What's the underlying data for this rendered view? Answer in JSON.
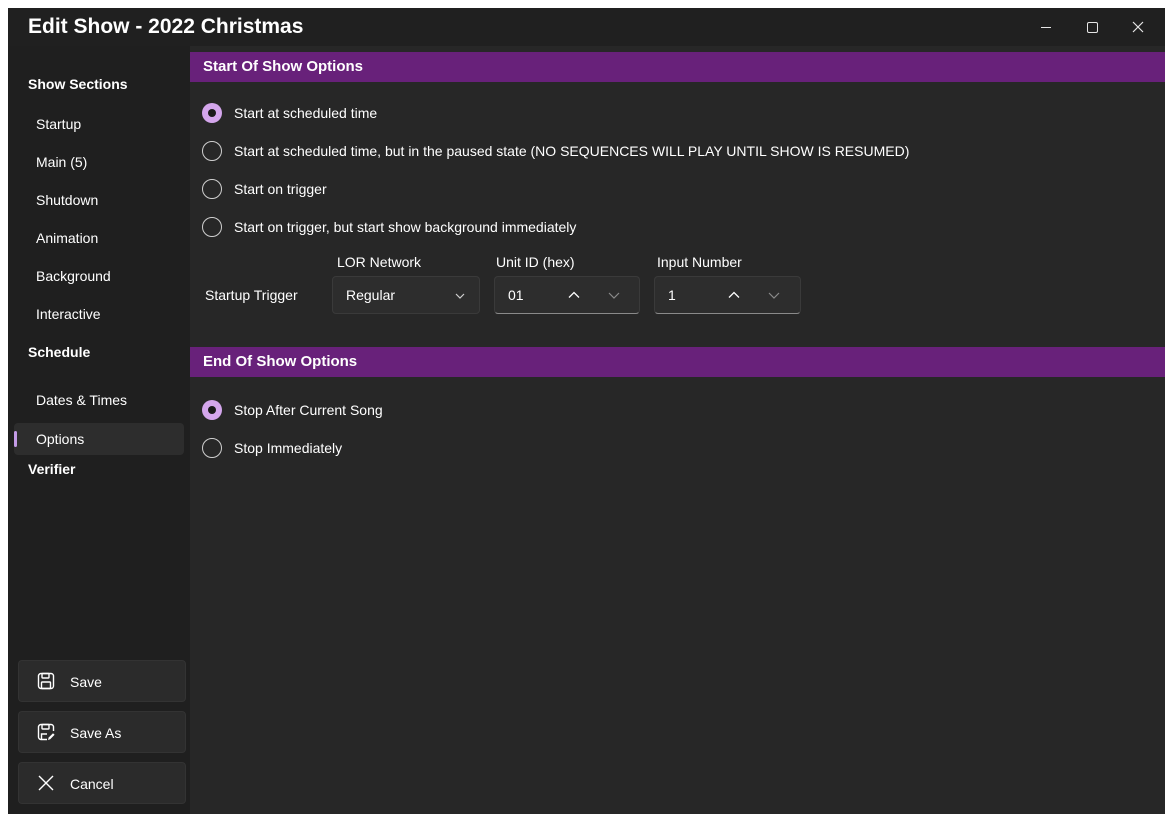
{
  "window": {
    "title": "Edit Show - 2022 Christmas",
    "controls": [
      "minimize-icon",
      "maximize-icon",
      "close-icon"
    ]
  },
  "sidebar": {
    "show_sections_header": "Show Sections",
    "show_sections": [
      {
        "label": "Startup"
      },
      {
        "label": "Main (5)"
      },
      {
        "label": "Shutdown"
      },
      {
        "label": "Animation"
      },
      {
        "label": "Background"
      },
      {
        "label": "Interactive"
      }
    ],
    "schedule_header": "Schedule",
    "schedule_items": [
      {
        "label": "Dates & Times"
      },
      {
        "label": "Options",
        "selected": true
      }
    ],
    "verifier_header": "Verifier",
    "buttons": {
      "save": "Save",
      "save_as": "Save As",
      "cancel": "Cancel"
    }
  },
  "start_options": {
    "header": "Start Of Show Options",
    "radios": [
      {
        "label": "Start at scheduled time",
        "checked": true
      },
      {
        "label": "Start at scheduled time, but in the paused state (NO SEQUENCES WILL PLAY UNTIL SHOW IS RESUMED)",
        "checked": false
      },
      {
        "label": "Start on trigger",
        "checked": false
      },
      {
        "label": "Start on trigger, but start show background immediately",
        "checked": false
      }
    ],
    "trigger": {
      "label": "Startup Trigger",
      "network_label": "LOR Network",
      "network_value": "Regular",
      "unit_label": "Unit ID (hex)",
      "unit_value": "01",
      "input_label": "Input Number",
      "input_value": "1"
    }
  },
  "end_options": {
    "header": "End Of Show Options",
    "radios": [
      {
        "label": "Stop After Current Song",
        "checked": true
      },
      {
        "label": "Stop Immediately",
        "checked": false
      }
    ]
  },
  "colors": {
    "accent": "#68217a",
    "radio_selected": "#d4a6ec",
    "selection_indicator": "#c39be6",
    "background": "#272727"
  }
}
